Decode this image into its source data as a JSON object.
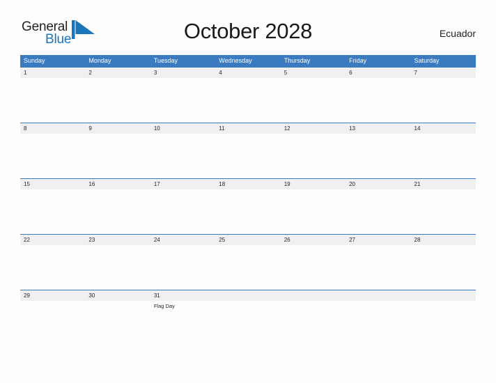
{
  "brand": {
    "name_part1": "General",
    "name_part2": "Blue",
    "flag_icon": "flag-icon",
    "color_dark": "#231f20",
    "color_blue": "#1b75bb"
  },
  "header": {
    "title": "October 2028",
    "country": "Ecuador"
  },
  "calendar": {
    "header_color": "#3a7ac0",
    "band_color": "#f0f0f0",
    "weekdays": [
      "Sunday",
      "Monday",
      "Tuesday",
      "Wednesday",
      "Thursday",
      "Friday",
      "Saturday"
    ],
    "weeks": [
      {
        "days": [
          {
            "num": "1",
            "event": ""
          },
          {
            "num": "2",
            "event": ""
          },
          {
            "num": "3",
            "event": ""
          },
          {
            "num": "4",
            "event": ""
          },
          {
            "num": "5",
            "event": ""
          },
          {
            "num": "6",
            "event": ""
          },
          {
            "num": "7",
            "event": ""
          }
        ]
      },
      {
        "days": [
          {
            "num": "8",
            "event": ""
          },
          {
            "num": "9",
            "event": ""
          },
          {
            "num": "10",
            "event": ""
          },
          {
            "num": "11",
            "event": ""
          },
          {
            "num": "12",
            "event": ""
          },
          {
            "num": "13",
            "event": ""
          },
          {
            "num": "14",
            "event": ""
          }
        ]
      },
      {
        "days": [
          {
            "num": "15",
            "event": ""
          },
          {
            "num": "16",
            "event": ""
          },
          {
            "num": "17",
            "event": ""
          },
          {
            "num": "18",
            "event": ""
          },
          {
            "num": "19",
            "event": ""
          },
          {
            "num": "20",
            "event": ""
          },
          {
            "num": "21",
            "event": ""
          }
        ]
      },
      {
        "days": [
          {
            "num": "22",
            "event": ""
          },
          {
            "num": "23",
            "event": ""
          },
          {
            "num": "24",
            "event": ""
          },
          {
            "num": "25",
            "event": ""
          },
          {
            "num": "26",
            "event": ""
          },
          {
            "num": "27",
            "event": ""
          },
          {
            "num": "28",
            "event": ""
          }
        ]
      },
      {
        "days": [
          {
            "num": "29",
            "event": ""
          },
          {
            "num": "30",
            "event": ""
          },
          {
            "num": "31",
            "event": "Flag Day"
          },
          {
            "num": "",
            "event": ""
          },
          {
            "num": "",
            "event": ""
          },
          {
            "num": "",
            "event": ""
          },
          {
            "num": "",
            "event": ""
          }
        ]
      }
    ]
  }
}
